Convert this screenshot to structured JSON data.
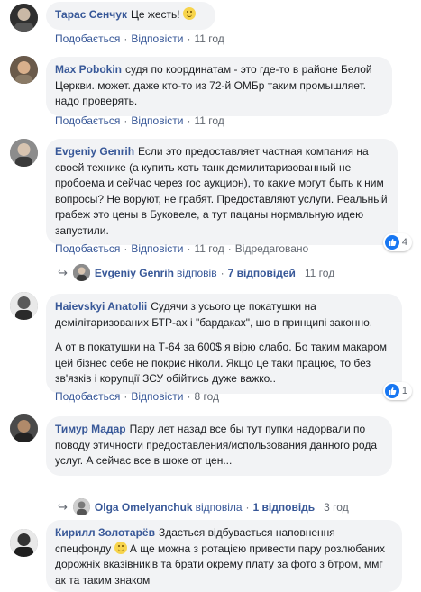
{
  "comments": [
    {
      "author": "Тарас Сенчук",
      "text": "Це жесть!",
      "has_emoji": true,
      "actions": {
        "like": "Подобається",
        "reply": "Відповісти",
        "time": "11 год"
      }
    },
    {
      "author": "Max Pobokin",
      "text": "судя по координатам - это где-то в районе Белой Церкви. может. даже кто-то из 72-й ОМБр таким промышляет. надо проверять.",
      "actions": {
        "like": "Подобається",
        "reply": "Відповісти",
        "time": "11 год"
      }
    },
    {
      "author": "Evgeniy Genrih",
      "text": "Если это предоставляет частная компания на своей технике (а купить хоть танк демилитаризованный не пробоема и сейчас через гос аукцион), то какие могут быть к ним вопросы? Не воруют, не грабят. Предоставляют услуги. Реальный грабеж это цены в Буковеле, а тут пацаны нормальную идею запустили.",
      "actions": {
        "like": "Подобається",
        "reply": "Відповісти",
        "time": "11 год",
        "edited": "Відредаговано"
      },
      "reactions": "4",
      "reply_summary": {
        "name": "Evgeniy Genrih",
        "verb": "відповів",
        "count": "7 відповідей",
        "time": "11 год"
      }
    },
    {
      "author": "Haievskyi Anatolii",
      "text": "Судячи з усього це покатушки на демілітаризованих БТР-ах і \"бардаках\", шо в принципі законно.",
      "text2": "А от в покатушки на Т-64 за 600$ я вірю слабо. Бо таким макаром цей бізнес себе не покриє ніколи. Якщо це таки працює, то без зв'язків і корупції ЗСУ обійтись дуже важко..",
      "actions": {
        "like": "Подобається",
        "reply": "Відповісти",
        "time": "8 год"
      },
      "reactions": "1"
    },
    {
      "author": "Тимур Мадар",
      "text": "Пару лет назад все бы тут пупки надорвали по поводу этичности предоставления/использования данного рода услуг. А сейчас все в шоке от цен...",
      "reply_summary": {
        "name": "Olga Omelyanchuk",
        "verb": "відповіла",
        "count": "1 відповідь",
        "time": "3 год"
      }
    },
    {
      "author": "Кирилл Золотарёв",
      "text_a": "Здається відбувається наповнення спецфонду",
      "text_b": "А ще можна з ротацією привести пару розлюбаних дорожніх вказівників та брати окрему плату за фото з бтром, ммг ак та таким знаком"
    }
  ],
  "colors": {
    "link": "#385898",
    "bubble": "#f2f3f5",
    "muted": "#616770",
    "like": "#1877f2"
  }
}
